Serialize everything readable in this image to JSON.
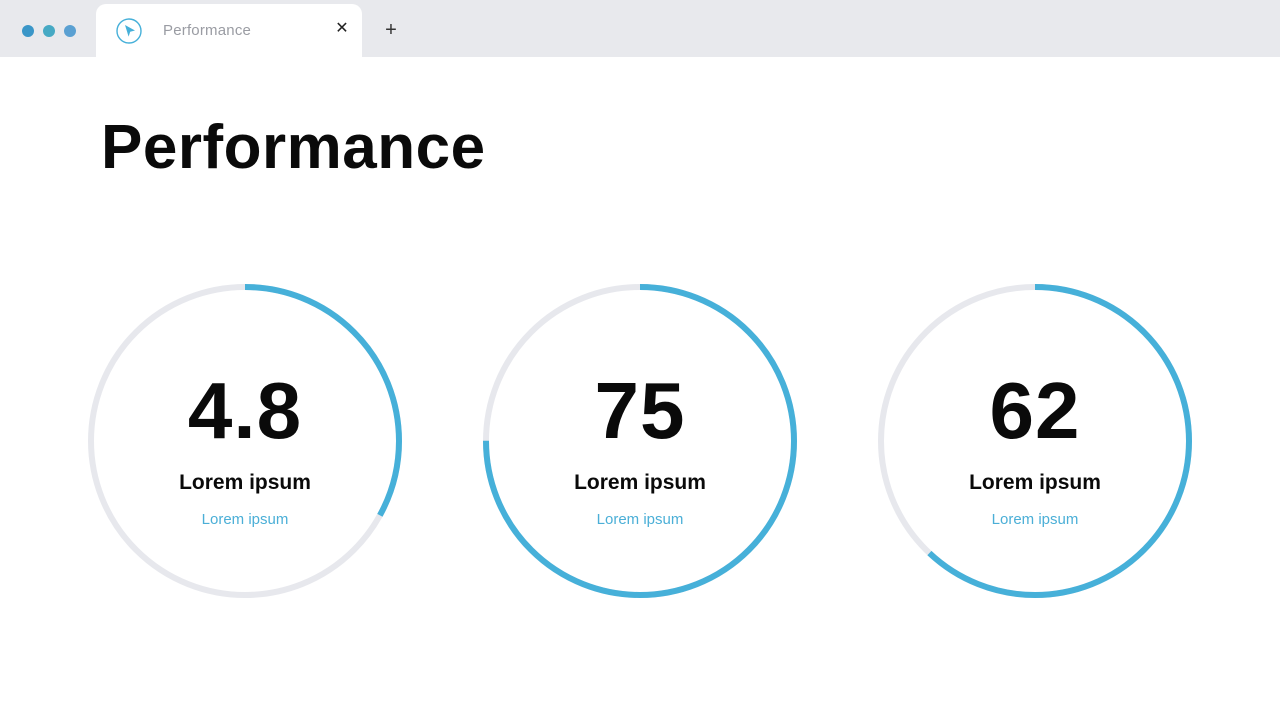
{
  "window": {
    "tab_title": "Performance",
    "close_glyph": "✕",
    "new_tab_glyph": "+",
    "icons": {
      "tab_logo": "cursor-logo-icon",
      "close": "close-icon",
      "new_tab": "plus-icon"
    }
  },
  "colors": {
    "accent": "#46b0d9",
    "track": "#e7e8ed",
    "titlebar": "#e8e9ed"
  },
  "page": {
    "title": "Performance"
  },
  "cards": [
    {
      "value": "4.8",
      "label": "Lorem ipsum",
      "sublabel": "Lorem ipsum",
      "progress": 0.33
    },
    {
      "value": "75",
      "label": "Lorem ipsum",
      "sublabel": "Lorem ipsum",
      "progress": 0.75
    },
    {
      "value": "62",
      "label": "Lorem ipsum",
      "sublabel": "Lorem ipsum",
      "progress": 0.62
    }
  ]
}
